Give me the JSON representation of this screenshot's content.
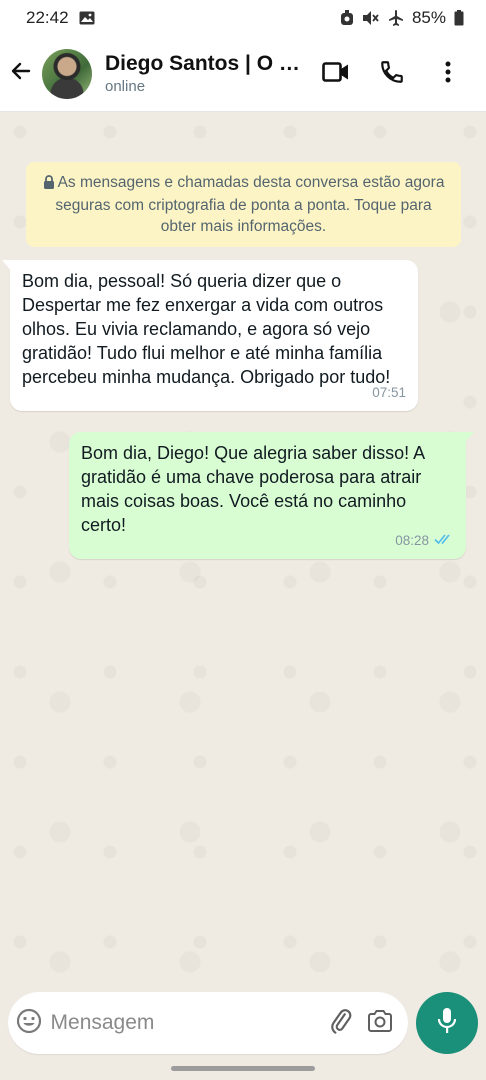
{
  "status_bar": {
    "time": "22:42",
    "battery": "85%",
    "icons": [
      "gallery-icon",
      "alarm-icon",
      "mute-icon",
      "airplane-icon",
      "battery-icon"
    ]
  },
  "header": {
    "contact_name": "Diego Santos | O Despertar",
    "contact_status": "online",
    "icons": [
      "back-arrow-icon",
      "video-call-icon",
      "phone-icon",
      "more-vert-icon"
    ]
  },
  "chat": {
    "encryption_notice": "As mensagens e chamadas desta conversa estão agora seguras com criptografia de ponta a ponta. Toque para obter mais informações.",
    "messages": [
      {
        "direction": "incoming",
        "text": "Bom dia, pessoal! Só queria dizer que o Despertar me fez enxergar a vida com outros olhos. Eu vivia reclamando, e agora só vejo gratidão! Tudo flui melhor e até minha família percebeu minha mudança. Obrigado por tudo!",
        "time": "07:51"
      },
      {
        "direction": "outgoing",
        "text": "Bom dia, Diego! Que alegria saber disso! A gratidão é uma chave poderosa para atrair mais coisas boas. Você está no caminho certo!",
        "time": "08:28",
        "status": "read"
      }
    ]
  },
  "composer": {
    "placeholder": "Mensagem",
    "value": ""
  },
  "colors": {
    "accent": "#1a8f7a",
    "outgoing_bubble": "#d9fdd3",
    "incoming_bubble": "#ffffff",
    "notice_bg": "#fdf4c5",
    "read_ticks": "#53bdeb"
  }
}
